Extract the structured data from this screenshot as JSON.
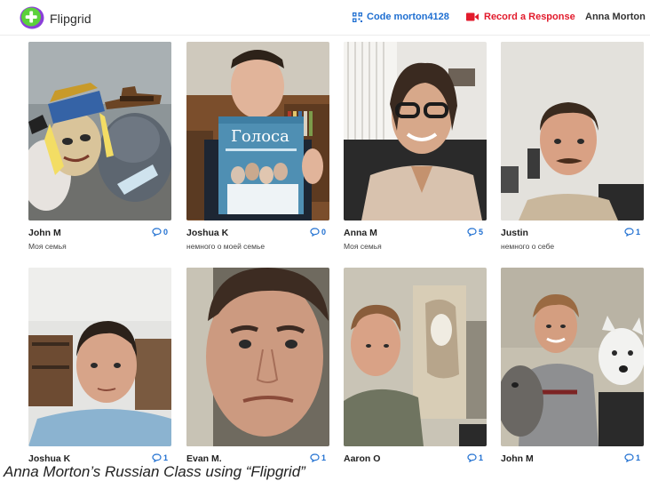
{
  "header": {
    "brand": "Flipgrid",
    "code_label": "Code morton4128",
    "record_label": "Record a Response",
    "user_name": "Anna Morton"
  },
  "tiles": [
    {
      "name": "John M",
      "subtitle": "Моя семья",
      "count": "0"
    },
    {
      "name": "Joshua K",
      "subtitle": "немного о моей семье",
      "count": "0"
    },
    {
      "name": "Anna M",
      "subtitle": "Моя семья",
      "count": "5"
    },
    {
      "name": "Justin",
      "subtitle": "немного о себе",
      "count": "1"
    },
    {
      "name": "Joshua K",
      "subtitle": "",
      "count": "1"
    },
    {
      "name": "Evan M.",
      "subtitle": "",
      "count": "1"
    },
    {
      "name": "Aaron O",
      "subtitle": "",
      "count": "1"
    },
    {
      "name": "John M",
      "subtitle": "",
      "count": "1"
    }
  ],
  "book_title": "Голоса",
  "caption": "Anna Morton’s Russian Class using “Flipgrid”",
  "colors": {
    "accent": "#1f6fd1",
    "record": "#e21b2c",
    "logo_green": "#5bd13b",
    "logo_purple": "#8b3fd9"
  },
  "icons": [
    "flipgrid-logo-icon",
    "qr-code-icon",
    "video-camera-icon",
    "chevron-down-icon",
    "comment-icon"
  ]
}
